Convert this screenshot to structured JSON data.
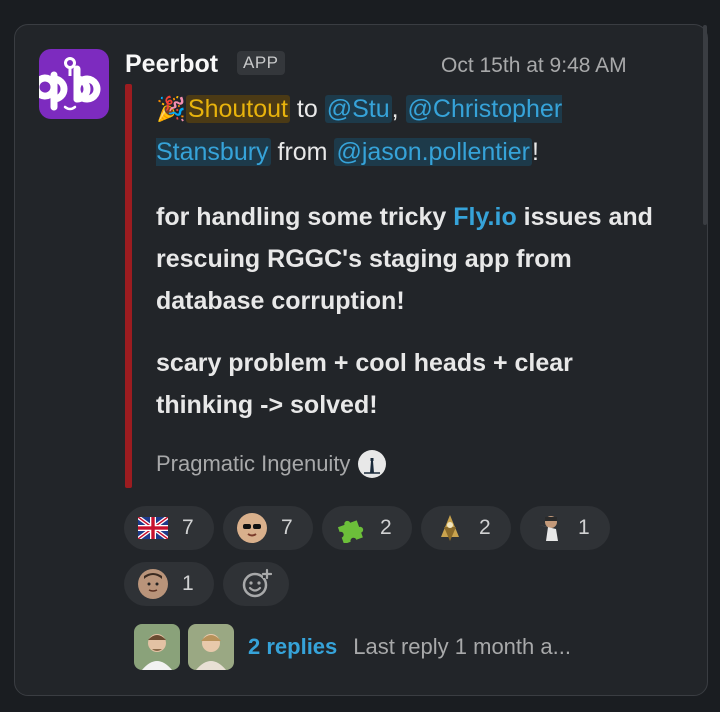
{
  "message": {
    "sender": "Peerbot",
    "badge": "APP",
    "timestamp": "Oct 15th at 9:48 AM",
    "line1": {
      "party_emoji": "🎉",
      "shoutout": "Shoutout",
      "to": " to ",
      "mention1": "@Stu",
      "comma": ",",
      "mention2": "@Christopher Stansbury",
      "from": " from ",
      "mention3": "@jason.pollentier",
      "bang": "!"
    },
    "para2": {
      "pre": "for handling some tricky ",
      "link": "Fly.io",
      "post": " issues and rescuing RGGC's staging app from database corruption!"
    },
    "para3": "scary problem + cool heads + clear thinking -> solved!",
    "signature": "Pragmatic Ingenuity"
  },
  "reactions": [
    {
      "icon": "uk-flag-icon",
      "count": "7"
    },
    {
      "icon": "sunglasses-face-icon",
      "count": "7"
    },
    {
      "icon": "puzzle-piece-icon",
      "count": "2"
    },
    {
      "icon": "wizard-icon",
      "count": "2"
    },
    {
      "icon": "person-icon",
      "count": "1"
    },
    {
      "icon": "person-face-icon",
      "count": "1"
    }
  ],
  "thread": {
    "replies": "2 replies",
    "last_reply": "Last reply 1 month a..."
  },
  "colors": {
    "accent_link": "#36a3d9",
    "quote_bar": "#9c1c20",
    "highlight": "#e8b30c",
    "avatar_bg": "#7d2bbf"
  }
}
